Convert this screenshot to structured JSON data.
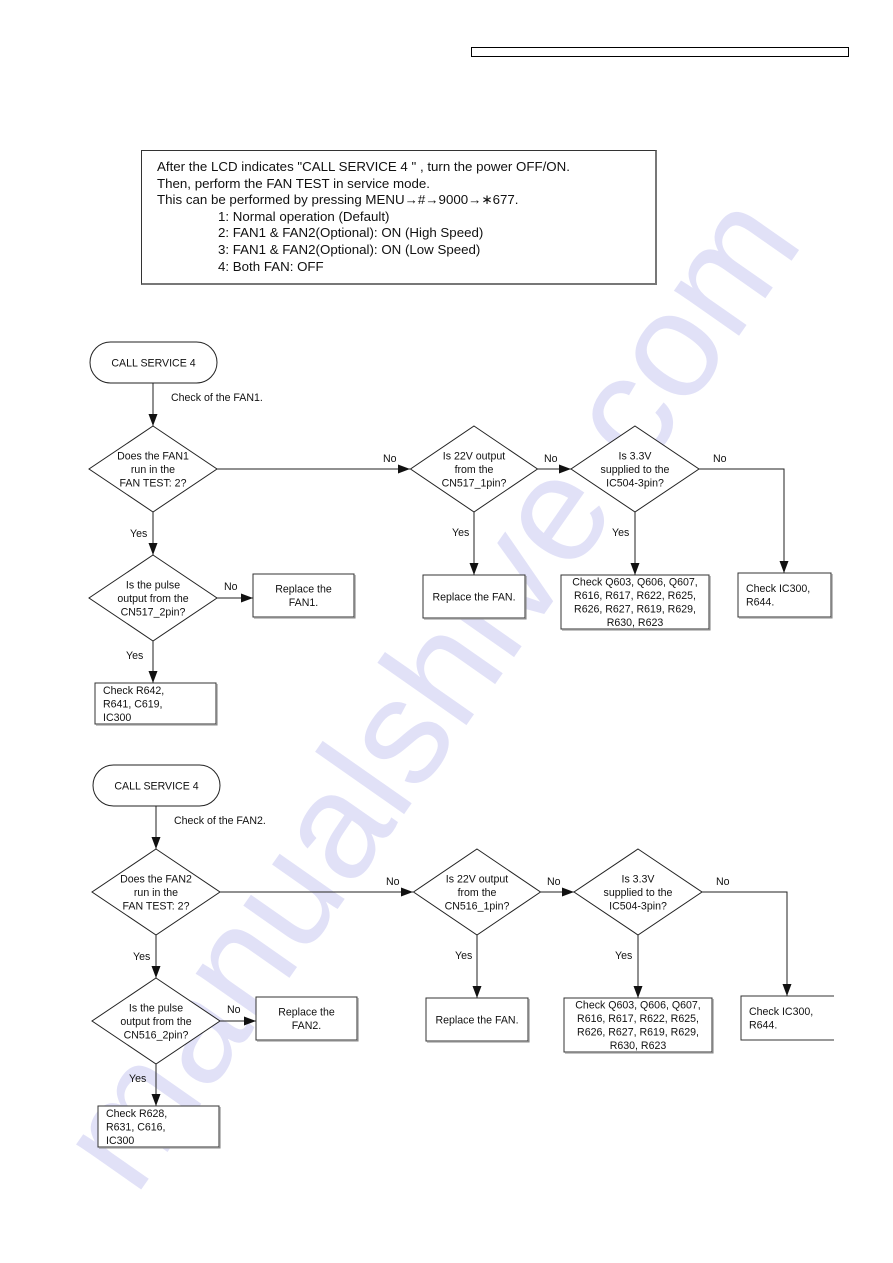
{
  "note": {
    "lines": [
      "After the LCD indicates \"CALL SERVICE 4 \" , turn the power OFF/ON.",
      "Then, perform the FAN TEST in service mode.",
      "This can be performed by pressing  MENU→#→9000→∗677."
    ],
    "options": [
      "1: Normal operation (Default)",
      "2: FAN1 & FAN2(Optional): ON (High Speed)",
      "3: FAN1 & FAN2(Optional): ON (Low Speed)",
      "4: Both FAN: OFF"
    ]
  },
  "watermark": "manualshive.com",
  "flowcharts": [
    {
      "start": "CALL SERVICE 4",
      "start_note": "Check of the FAN1.",
      "q1": [
        "Does the FAN1",
        "run in the",
        "FAN TEST: 2?"
      ],
      "q2": [
        "Is 22V output",
        "from the",
        "CN517_1pin?"
      ],
      "q3": [
        "Is 3.3V",
        "supplied to the",
        "IC504-3pin?"
      ],
      "q4": [
        "Is the pulse",
        "output from the",
        "CN517_2pin?"
      ],
      "r_replace_fan_x": [
        "Replace the",
        "FAN1."
      ],
      "r_replace_fan": [
        "Replace the FAN."
      ],
      "r_check_q": [
        "Check Q603, Q606, Q607,",
        "R616, R617, R622, R625,",
        "R626, R627, R619, R629,",
        "R630, R623"
      ],
      "r_check_ic": [
        "Check IC300,",
        "R644."
      ],
      "r_check_r": [
        "Check R642,",
        "R641, C619,",
        "IC300"
      ],
      "labels": {
        "yes": "Yes",
        "no": "No"
      }
    },
    {
      "start": "CALL SERVICE 4",
      "start_note": "Check of the FAN2.",
      "q1": [
        "Does the FAN2",
        "run in the",
        "FAN TEST: 2?"
      ],
      "q2": [
        "Is 22V output",
        "from the",
        "CN516_1pin?"
      ],
      "q3": [
        "Is 3.3V",
        "supplied to the",
        "IC504-3pin?"
      ],
      "q4": [
        "Is the pulse",
        "output from the",
        "CN516_2pin?"
      ],
      "r_replace_fan_x": [
        "Replace the",
        "FAN2."
      ],
      "r_replace_fan": [
        "Replace the FAN."
      ],
      "r_check_q": [
        "Check Q603, Q606, Q607,",
        "R616, R617, R622, R625,",
        "R626, R627, R619, R629,",
        "R630, R623"
      ],
      "r_check_ic": [
        "Check IC300,",
        "R644."
      ],
      "r_check_r": [
        "Check R628,",
        "R631, C616,",
        "IC300"
      ],
      "labels": {
        "yes": "Yes",
        "no": "No"
      }
    }
  ]
}
